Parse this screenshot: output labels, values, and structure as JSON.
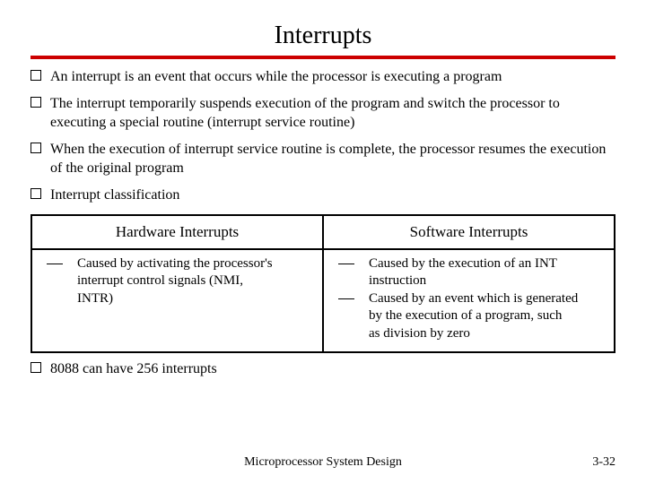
{
  "title": "Interrupts",
  "bullets": [
    "An interrupt is an event that occurs while the processor is executing a program",
    "The interrupt temporarily suspends execution of the program and switch the processor to executing a special routine (interrupt service routine)",
    "When the execution of interrupt service  routine is complete, the processor resumes the execution of the original program",
    "Interrupt classification"
  ],
  "table": {
    "headers": [
      "Hardware Interrupts",
      "Software Interrupts"
    ],
    "hw": {
      "d1": "Caused by activating the processor's",
      "c1": "interrupt control signals (NMI,",
      "c2": "INTR)"
    },
    "sw": {
      "d1": "Caused by the execution of an INT",
      "c1": "instruction",
      "d2": "Caused by an event which is generated",
      "c2": "by the execution of a program, such",
      "c3": "as division by zero"
    }
  },
  "last_bullet": "8088 can have 256 interrupts",
  "footer": {
    "center": "Microprocessor System Design",
    "right": "3-32"
  }
}
